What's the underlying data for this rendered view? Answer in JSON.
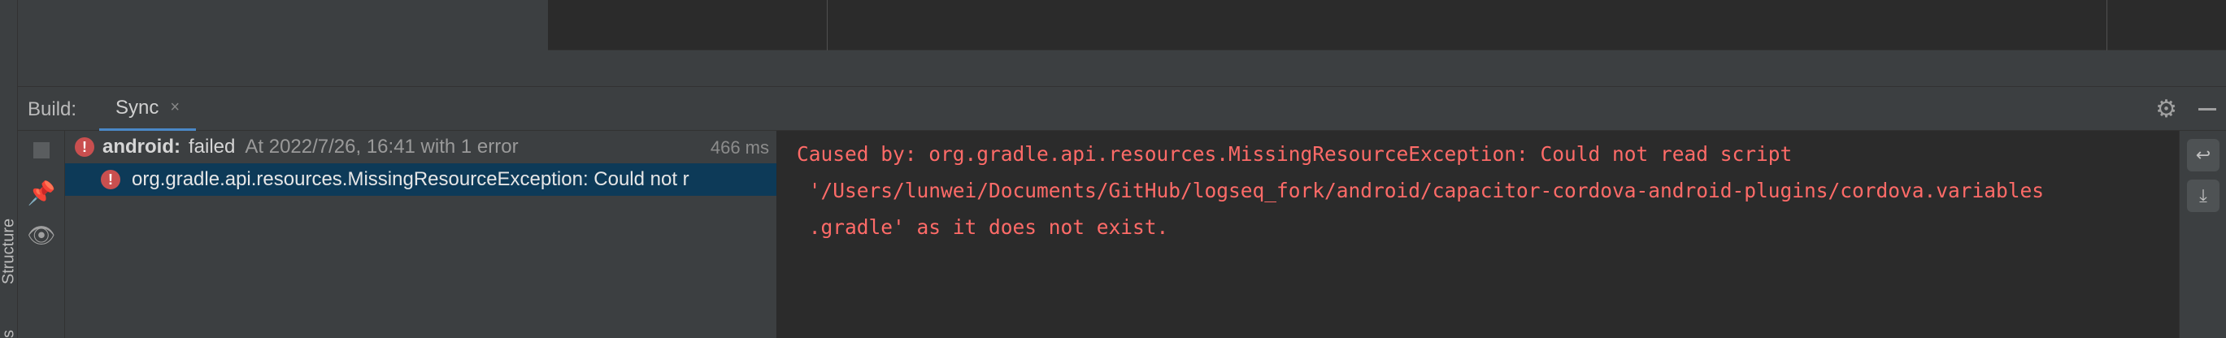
{
  "left_strip": {
    "structure_label": "Structure",
    "bottom_label": "s"
  },
  "header": {
    "title": "Build:",
    "tab_sync_label": "Sync",
    "tab_close_glyph": "×"
  },
  "icons": {
    "settings": "gear-icon",
    "hide": "minimize-icon",
    "stop": "stop-icon",
    "pin": "pin-icon",
    "eye": "eye-icon",
    "error": "error-icon",
    "soft_wrap": "soft-wrap-icon",
    "scroll_end": "scroll-to-end-icon"
  },
  "tree": {
    "row1": {
      "name": "android:",
      "status": "failed",
      "meta": "At 2022/7/26, 16:41 with 1 error",
      "duration": "466 ms"
    },
    "row2": {
      "message": "org.gradle.api.resources.MissingResourceException: Could not r"
    }
  },
  "console": {
    "lines": [
      "Caused by: org.gradle.api.resources.MissingResourceException: Could not read script",
      " '/Users/lunwei/Documents/GitHub/logseq_fork/android/capacitor-cordova-android-plugins/cordova.variables",
      " .gradle' as it does not exist."
    ]
  },
  "colors": {
    "error_text": "#ff6b68",
    "selection": "#0d3a58",
    "tab_underline": "#4a88c7",
    "error_icon": "#c94f4f"
  }
}
